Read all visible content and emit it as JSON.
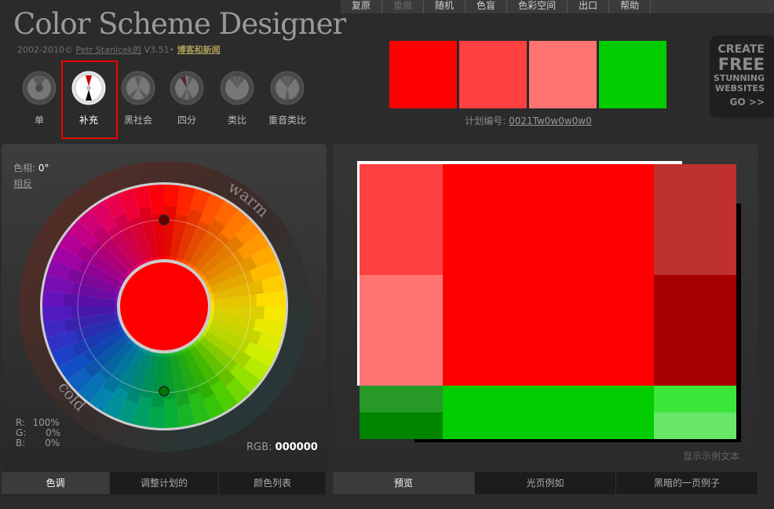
{
  "app": {
    "title": "Color Scheme Designer",
    "credits_years": "2002-2010©",
    "author": "Petr Stanicek的",
    "version": "V3.51•",
    "blog_link": "博客和新闻"
  },
  "menu": [
    {
      "label": "复原",
      "enabled": true
    },
    {
      "label": "重做",
      "enabled": false
    },
    {
      "label": "随机",
      "enabled": true
    },
    {
      "label": "色盲",
      "enabled": true
    },
    {
      "label": "色彩空间",
      "enabled": true
    },
    {
      "label": "出口",
      "enabled": true
    },
    {
      "label": "帮助",
      "enabled": true
    }
  ],
  "schemes": [
    {
      "label": "单",
      "active": false
    },
    {
      "label": "补充",
      "active": true
    },
    {
      "label": "黑社会",
      "active": false
    },
    {
      "label": "四分",
      "active": false
    },
    {
      "label": "类比",
      "active": false
    },
    {
      "label": "重音类比",
      "active": false
    }
  ],
  "swatches": [
    "#FF0000",
    "#FF4040",
    "#FF7373",
    "#00CC00"
  ],
  "scheme_id_label": "计划编号:",
  "scheme_id": "0021Tw0w0w0w0",
  "ad": {
    "line1": "CREATE",
    "line2": "FREE",
    "line3": "STUNNING",
    "line4": "WEBSITES",
    "line5": "GO >>"
  },
  "hue": {
    "label": "色相:",
    "value": "0°",
    "complement": "相反"
  },
  "wheel": {
    "warm_label": "warm",
    "cold_label": "cold",
    "center_color": "#FF0000",
    "ring_dark_warm": "#5a2e25",
    "ring_dark_cold": "#1f3c3f"
  },
  "rgb": {
    "r_label": "R:",
    "r": "100%",
    "g_label": "G:",
    "g": "0%",
    "b_label": "B:",
    "b": "0%",
    "readout_label": "RGB:",
    "readout_value": "000000"
  },
  "left_tabs": [
    {
      "label": "色调",
      "active": true
    },
    {
      "label": "调整计划的",
      "active": false
    },
    {
      "label": "颜色列表",
      "active": false
    }
  ],
  "right_tabs": [
    {
      "label": "预览",
      "active": true
    },
    {
      "label": "光页例如",
      "active": false
    },
    {
      "label": "黑暗的一页例子",
      "active": false
    }
  ],
  "preview_colors": {
    "primary": "#FF0000",
    "light1": "#FF4040",
    "light2": "#FF7373",
    "dark1": "#BF3030",
    "dark2": "#A60000",
    "comp": "#00CC00",
    "comp_dark1": "#269926",
    "comp_dark2": "#008500",
    "comp_light1": "#39E639",
    "comp_light2": "#67E667"
  },
  "show_sample_text": "显示示例文本"
}
